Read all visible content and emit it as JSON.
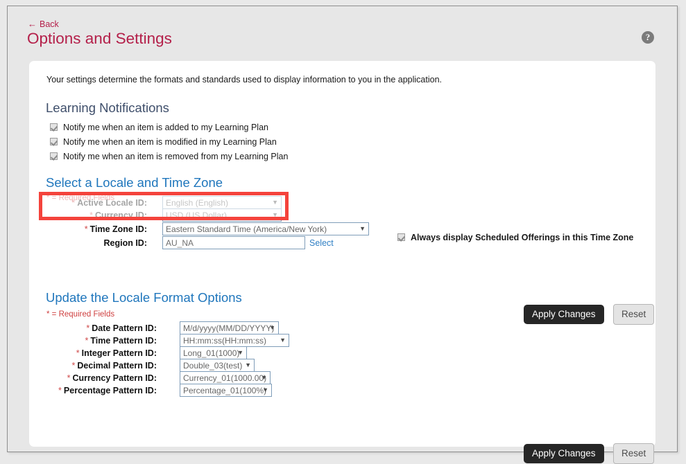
{
  "header": {
    "back_label": "Back",
    "back_arrow": "←",
    "title": "Options and Settings",
    "help_icon_glyph": "?"
  },
  "card": {
    "intro_text": "Your settings determine the formats and standards used to display information to you in the application."
  },
  "learning_notifications": {
    "heading": "Learning Notifications",
    "items": [
      {
        "label": "Notify me when an item is added to my Learning Plan",
        "checked": true
      },
      {
        "label": "Notify me when an item is modified in my Learning Plan",
        "checked": true
      },
      {
        "label": "Notify me when an item is removed from my Learning Plan",
        "checked": true
      }
    ]
  },
  "locale_timezone": {
    "heading": "Select a Locale and Time Zone",
    "required_note": "* = Required Fields",
    "fields": {
      "active_locale": {
        "label": "Active Locale ID:",
        "required": true,
        "value": "English (English)"
      },
      "currency": {
        "label": "Currency ID:",
        "required": true,
        "value": "USD (US Dollar)"
      },
      "time_zone": {
        "label": "Time Zone ID:",
        "required": true,
        "value": "Eastern Standard Time (America/New York)"
      },
      "region": {
        "label": "Region ID:",
        "required": false,
        "value": "AU_NA",
        "select_link": "Select"
      }
    },
    "always_display_checkbox": {
      "label": "Always display Scheduled Offerings in this Time Zone",
      "checked": true
    },
    "apply_label": "Apply Changes",
    "reset_label": "Reset"
  },
  "format_options": {
    "heading": "Update the Locale Format Options",
    "required_note": "* = Required Fields",
    "fields": [
      {
        "label": "Date Pattern ID:",
        "value": "M/d/yyyy(MM/DD/YYYY)",
        "width": 143
      },
      {
        "label": "Time Pattern ID:",
        "value": "HH:mm:ss(HH:mm:ss)",
        "width": 158
      },
      {
        "label": "Integer Pattern ID:",
        "value": "Long_01(1000)",
        "width": 97
      },
      {
        "label": "Decimal Pattern ID:",
        "value": "Double_03(test)",
        "width": 108
      },
      {
        "label": "Currency Pattern ID:",
        "value": "Currency_01(1000.00)",
        "width": 131
      },
      {
        "label": "Percentage Pattern ID:",
        "value": "Percentage_01(100%)",
        "width": 133
      }
    ],
    "apply_label": "Apply Changes",
    "reset_label": "Reset"
  },
  "annotation": {
    "highlight_color": "#f4433c",
    "highlight_target": "active-locale-id-row"
  },
  "colors": {
    "title_red": "#b4204a",
    "heading_blue": "#1f76bc",
    "heading_slate": "#3f4f6b",
    "required_red": "#cf4040",
    "link_blue": "#2f7fc4",
    "button_dark": "#262626",
    "page_bg": "#e7e7e7"
  }
}
